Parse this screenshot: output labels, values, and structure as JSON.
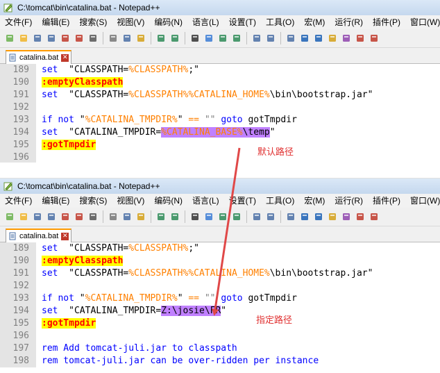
{
  "window": {
    "title": "C:\\tomcat\\bin\\catalina.bat - Notepad++"
  },
  "menu": [
    "文件(F)",
    "编辑(E)",
    "搜索(S)",
    "视图(V)",
    "编码(N)",
    "语言(L)",
    "设置(T)",
    "工具(O)",
    "宏(M)",
    "运行(R)",
    "插件(P)",
    "窗口(W)"
  ],
  "tab": {
    "label": "catalina.bat",
    "close_glyph": "✕"
  },
  "toolbar_icons": [
    "new-file-icon",
    "open-file-icon",
    "save-icon",
    "save-all-icon",
    "close-file-icon",
    "close-all-icon",
    "print-icon",
    "cut-icon",
    "copy-icon",
    "paste-icon",
    "undo-icon",
    "redo-icon",
    "find-icon",
    "replace-icon",
    "zoom-in-icon",
    "zoom-out-icon",
    "sync-vertical-icon",
    "sync-horizontal-icon",
    "word-wrap-icon",
    "show-all-chars-icon",
    "indent-guide-icon",
    "folder-as-workspace-icon",
    "function-list-icon",
    "record-macro-icon",
    "stop-record-icon"
  ],
  "panel1": {
    "lines": [
      {
        "no": "189",
        "parts": [
          [
            "kw",
            "set"
          ],
          [
            "",
            "  \"CLASSPATH="
          ],
          [
            "var",
            "%CLASSPATH%"
          ],
          [
            "",
            ";\""
          ]
        ]
      },
      {
        "no": "190",
        "parts": [
          [
            "lbl",
            ":emptyClasspath"
          ]
        ]
      },
      {
        "no": "191",
        "parts": [
          [
            "kw",
            "set"
          ],
          [
            "",
            "  \"CLASSPATH="
          ],
          [
            "var",
            "%CLASSPATH%%CATALINA_HOME%"
          ],
          [
            "",
            "\\bin\\bootstrap.jar\""
          ]
        ]
      },
      {
        "no": "192",
        "parts": []
      },
      {
        "no": "193",
        "parts": [
          [
            "kw",
            "if not"
          ],
          [
            "",
            " \""
          ],
          [
            "var",
            "%CATALINA_TMPDIR%"
          ],
          [
            "",
            "\" "
          ],
          [
            "var",
            "=="
          ],
          [
            "str",
            " \"\" "
          ],
          [
            "kw",
            "goto"
          ],
          [
            "",
            " gotTmpdir"
          ]
        ]
      },
      {
        "no": "194",
        "parts": [
          [
            "kw",
            "set"
          ],
          [
            "",
            "  \"CATALINA_TMPDIR="
          ],
          [
            "hlvar",
            "%CATALINA_BASE%"
          ],
          [
            "hl",
            "\\temp"
          ],
          [
            "",
            "\""
          ]
        ]
      },
      {
        "no": "195",
        "parts": [
          [
            "lbl",
            ":gotTmpdir"
          ]
        ]
      },
      {
        "no": "196",
        "parts": []
      }
    ],
    "annotation": "默认路径"
  },
  "panel2": {
    "lines": [
      {
        "no": "189",
        "parts": [
          [
            "kw",
            "set"
          ],
          [
            "",
            "  \"CLASSPATH="
          ],
          [
            "var",
            "%CLASSPATH%"
          ],
          [
            "",
            ";\""
          ]
        ]
      },
      {
        "no": "190",
        "parts": [
          [
            "lbl",
            ":emptyClasspath"
          ]
        ]
      },
      {
        "no": "191",
        "parts": [
          [
            "kw",
            "set"
          ],
          [
            "",
            "  \"CLASSPATH="
          ],
          [
            "var",
            "%CLASSPATH%%CATALINA_HOME%"
          ],
          [
            "",
            "\\bin\\bootstrap.jar\""
          ]
        ]
      },
      {
        "no": "192",
        "parts": []
      },
      {
        "no": "193",
        "parts": [
          [
            "kw",
            "if not"
          ],
          [
            "",
            " \""
          ],
          [
            "var",
            "%CATALINA_TMPDIR%"
          ],
          [
            "",
            "\" "
          ],
          [
            "var",
            "=="
          ],
          [
            "str",
            " \"\" "
          ],
          [
            "kw",
            "goto"
          ],
          [
            "",
            " gotTmpdir"
          ]
        ]
      },
      {
        "no": "194",
        "parts": [
          [
            "kw",
            "set"
          ],
          [
            "",
            "  \"CATALINA_TMPDIR="
          ],
          [
            "hl",
            "Z:\\josie\\FR"
          ],
          [
            "",
            "\""
          ]
        ]
      },
      {
        "no": "195",
        "parts": [
          [
            "lbl",
            ":gotTmpdir"
          ]
        ]
      },
      {
        "no": "196",
        "parts": []
      },
      {
        "no": "197",
        "parts": [
          [
            "kw",
            "rem Add tomcat-juli.jar to classpath"
          ]
        ]
      },
      {
        "no": "198",
        "parts": [
          [
            "kw",
            "rem tomcat-juli.jar can be over-ridden per instance"
          ]
        ]
      }
    ],
    "annotation": "指定路径"
  },
  "colors": {
    "keyword": "#0000ff",
    "variable": "#ff8000",
    "label_bg": "#ffff00",
    "label_fg": "#ff0000",
    "highlight": "#c080ff",
    "annotation": "#e03030",
    "arrow": "#e04848"
  }
}
